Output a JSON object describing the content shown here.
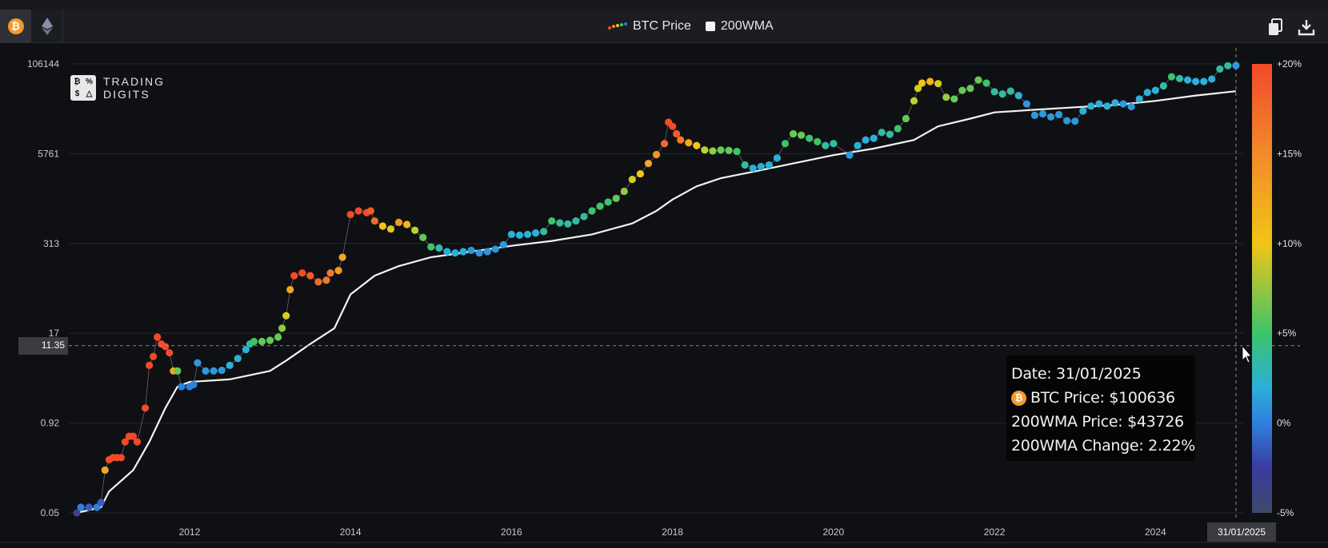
{
  "toolbar": {
    "coins": [
      {
        "icon": "bitcoin-icon",
        "active": true,
        "glyph": "₿"
      },
      {
        "icon": "ethereum-icon",
        "active": false
      }
    ],
    "legend": {
      "btc_label": "BTC Price",
      "wma_label": "200WMA"
    },
    "actions": [
      {
        "icon": "copy-icon"
      },
      {
        "icon": "download-icon"
      }
    ]
  },
  "logo": {
    "line1": "TRADING",
    "line2": "DIGITS",
    "glyphs": [
      "₿",
      "%",
      "$",
      "△"
    ]
  },
  "crosshair": {
    "y_value_label": "11.35",
    "x_value_label": "31/01/2025"
  },
  "tooltip": {
    "date": "Date: 31/01/2025",
    "btc_price": "BTC Price: $100636",
    "wma_price": "200WMA Price: $43726",
    "wma_change": "200WMA Change: 2.22%"
  },
  "colors": {
    "background": "#0f1013",
    "wma_line": "#f2f2f2",
    "grid": "#23252a",
    "scale": [
      "#3d4a6a",
      "#3b3b9e",
      "#2f7fe0",
      "#2bb0d8",
      "#3cc46a",
      "#b8d32a",
      "#f2c417",
      "#f28a2a",
      "#f24a2a"
    ]
  },
  "chart_data": {
    "type": "scatter",
    "y_scale": "log",
    "y_ticks": [
      0.05,
      0.92,
      17,
      313,
      5761,
      106144
    ],
    "y_tick_labels": [
      "0.05",
      "0.92",
      "17",
      "313",
      "5761",
      "106144"
    ],
    "ylim": [
      0.05,
      106144
    ],
    "x_ticks": [
      2012,
      2014,
      2016,
      2018,
      2020,
      2022,
      2024
    ],
    "x_tick_labels": [
      "2012",
      "2014",
      "2016",
      "2018",
      "2020",
      "2022",
      "2024"
    ],
    "xlim": [
      2010.5,
      2025.1
    ],
    "colorbar": {
      "labels": [
        "+20%",
        "+15%",
        "+10%",
        "+5%",
        "0%",
        "-5%"
      ],
      "range": [
        -5,
        20
      ]
    },
    "series": [
      {
        "name": "BTC Price",
        "points": [
          [
            2010.6,
            0.05,
            -3
          ],
          [
            2010.65,
            0.06,
            1
          ],
          [
            2010.75,
            0.06,
            0
          ],
          [
            2010.85,
            0.06,
            1
          ],
          [
            2010.9,
            0.07,
            0
          ],
          [
            2010.95,
            0.2,
            12
          ],
          [
            2011.0,
            0.28,
            19
          ],
          [
            2011.05,
            0.3,
            19
          ],
          [
            2011.1,
            0.3,
            19
          ],
          [
            2011.15,
            0.3,
            19
          ],
          [
            2011.2,
            0.5,
            20
          ],
          [
            2011.25,
            0.6,
            20
          ],
          [
            2011.3,
            0.6,
            20
          ],
          [
            2011.35,
            0.5,
            20
          ],
          [
            2011.45,
            1.5,
            20
          ],
          [
            2011.5,
            6.0,
            20
          ],
          [
            2011.55,
            8.0,
            20
          ],
          [
            2011.6,
            15,
            20
          ],
          [
            2011.65,
            12,
            20
          ],
          [
            2011.7,
            11,
            19
          ],
          [
            2011.75,
            9,
            18
          ],
          [
            2011.8,
            5,
            12
          ],
          [
            2011.85,
            5,
            6
          ],
          [
            2011.9,
            3,
            1
          ],
          [
            2012.0,
            3,
            1
          ],
          [
            2012.05,
            3.2,
            1
          ],
          [
            2012.1,
            6.5,
            2
          ],
          [
            2012.2,
            5,
            2
          ],
          [
            2012.3,
            5,
            2
          ],
          [
            2012.4,
            5.1,
            2
          ],
          [
            2012.5,
            6,
            3
          ],
          [
            2012.6,
            7.5,
            3
          ],
          [
            2012.7,
            10,
            3
          ],
          [
            2012.75,
            12,
            4
          ],
          [
            2012.8,
            13,
            5
          ],
          [
            2012.9,
            13,
            6
          ],
          [
            2013.0,
            13.5,
            6
          ],
          [
            2013.1,
            15,
            6
          ],
          [
            2013.15,
            20,
            7
          ],
          [
            2013.2,
            30,
            9
          ],
          [
            2013.25,
            70,
            12
          ],
          [
            2013.3,
            110,
            18
          ],
          [
            2013.4,
            120,
            19
          ],
          [
            2013.5,
            110,
            17
          ],
          [
            2013.6,
            90,
            16
          ],
          [
            2013.7,
            95,
            15
          ],
          [
            2013.75,
            120,
            15
          ],
          [
            2013.85,
            130,
            13
          ],
          [
            2013.9,
            200,
            12
          ],
          [
            2014.0,
            800,
            19
          ],
          [
            2014.1,
            900,
            19
          ],
          [
            2014.2,
            850,
            19
          ],
          [
            2014.25,
            900,
            17
          ],
          [
            2014.3,
            650,
            16
          ],
          [
            2014.4,
            550,
            10
          ],
          [
            2014.5,
            500,
            9
          ],
          [
            2014.6,
            620,
            13
          ],
          [
            2014.7,
            580,
            11
          ],
          [
            2014.8,
            480,
            8
          ],
          [
            2014.9,
            380,
            6
          ],
          [
            2015.0,
            280,
            5
          ],
          [
            2015.1,
            270,
            4
          ],
          [
            2015.2,
            240,
            3
          ],
          [
            2015.3,
            230,
            3
          ],
          [
            2015.4,
            240,
            3
          ],
          [
            2015.5,
            250,
            2
          ],
          [
            2015.6,
            230,
            2
          ],
          [
            2015.7,
            240,
            2
          ],
          [
            2015.8,
            260,
            2
          ],
          [
            2015.9,
            300,
            2
          ],
          [
            2016.0,
            420,
            3
          ],
          [
            2016.1,
            410,
            3
          ],
          [
            2016.2,
            420,
            3
          ],
          [
            2016.3,
            440,
            3
          ],
          [
            2016.4,
            460,
            4
          ],
          [
            2016.5,
            650,
            5
          ],
          [
            2016.6,
            610,
            4
          ],
          [
            2016.7,
            590,
            4
          ],
          [
            2016.8,
            650,
            4
          ],
          [
            2016.9,
            750,
            4
          ],
          [
            2017.0,
            900,
            5
          ],
          [
            2017.1,
            1050,
            5
          ],
          [
            2017.2,
            1200,
            5
          ],
          [
            2017.3,
            1350,
            6
          ],
          [
            2017.4,
            1700,
            7
          ],
          [
            2017.5,
            2500,
            9
          ],
          [
            2017.6,
            3000,
            10
          ],
          [
            2017.7,
            4200,
            12
          ],
          [
            2017.8,
            5600,
            13
          ],
          [
            2017.9,
            8000,
            16
          ],
          [
            2017.95,
            16000,
            20
          ],
          [
            2018.0,
            14000,
            19
          ],
          [
            2018.05,
            11000,
            17
          ],
          [
            2018.1,
            9000,
            15
          ],
          [
            2018.2,
            8200,
            12
          ],
          [
            2018.3,
            7500,
            10
          ],
          [
            2018.4,
            6500,
            8
          ],
          [
            2018.5,
            6300,
            7
          ],
          [
            2018.6,
            6500,
            6
          ],
          [
            2018.7,
            6400,
            6
          ],
          [
            2018.8,
            6200,
            5
          ],
          [
            2018.9,
            4000,
            4
          ],
          [
            2019.0,
            3600,
            3
          ],
          [
            2019.1,
            3800,
            3
          ],
          [
            2019.2,
            4000,
            3
          ],
          [
            2019.3,
            5000,
            3
          ],
          [
            2019.4,
            8000,
            5
          ],
          [
            2019.5,
            11000,
            6
          ],
          [
            2019.6,
            10500,
            6
          ],
          [
            2019.7,
            9500,
            5
          ],
          [
            2019.8,
            8500,
            5
          ],
          [
            2019.9,
            7500,
            4
          ],
          [
            2020.0,
            8000,
            4
          ],
          [
            2020.2,
            5500,
            2
          ],
          [
            2020.3,
            7500,
            3
          ],
          [
            2020.4,
            9000,
            3
          ],
          [
            2020.5,
            9500,
            3
          ],
          [
            2020.6,
            11500,
            4
          ],
          [
            2020.7,
            10800,
            4
          ],
          [
            2020.8,
            13000,
            5
          ],
          [
            2020.9,
            18000,
            6
          ],
          [
            2021.0,
            32000,
            8
          ],
          [
            2021.05,
            48000,
            9
          ],
          [
            2021.1,
            57000,
            10
          ],
          [
            2021.2,
            60000,
            11
          ],
          [
            2021.3,
            56000,
            9
          ],
          [
            2021.4,
            36000,
            7
          ],
          [
            2021.5,
            34000,
            6
          ],
          [
            2021.6,
            45000,
            6
          ],
          [
            2021.7,
            48000,
            6
          ],
          [
            2021.8,
            63000,
            6
          ],
          [
            2021.9,
            57000,
            5
          ],
          [
            2022.0,
            43000,
            4
          ],
          [
            2022.1,
            40000,
            4
          ],
          [
            2022.2,
            44000,
            4
          ],
          [
            2022.3,
            38000,
            3
          ],
          [
            2022.4,
            29000,
            2
          ],
          [
            2022.5,
            20000,
            2
          ],
          [
            2022.6,
            21000,
            2
          ],
          [
            2022.7,
            19000,
            2
          ],
          [
            2022.8,
            20500,
            2
          ],
          [
            2022.9,
            16800,
            2
          ],
          [
            2023.0,
            16500,
            2
          ],
          [
            2023.1,
            23000,
            3
          ],
          [
            2023.2,
            27000,
            3
          ],
          [
            2023.3,
            29000,
            3
          ],
          [
            2023.4,
            27000,
            3
          ],
          [
            2023.5,
            30000,
            3
          ],
          [
            2023.6,
            29000,
            2
          ],
          [
            2023.7,
            26500,
            2
          ],
          [
            2023.8,
            34000,
            3
          ],
          [
            2023.9,
            42000,
            3
          ],
          [
            2024.0,
            45000,
            3
          ],
          [
            2024.1,
            52000,
            4
          ],
          [
            2024.2,
            70000,
            5
          ],
          [
            2024.3,
            66000,
            4
          ],
          [
            2024.4,
            63000,
            3
          ],
          [
            2024.5,
            60000,
            3
          ],
          [
            2024.6,
            60000,
            3
          ],
          [
            2024.7,
            65000,
            3
          ],
          [
            2024.8,
            90000,
            4
          ],
          [
            2024.9,
            100000,
            4
          ],
          [
            2025.0,
            100636,
            2
          ]
        ]
      },
      {
        "name": "200WMA",
        "points": [
          [
            2010.6,
            0.05
          ],
          [
            2010.9,
            0.06
          ],
          [
            2011.0,
            0.1
          ],
          [
            2011.3,
            0.2
          ],
          [
            2011.5,
            0.5
          ],
          [
            2011.7,
            1.5
          ],
          [
            2011.85,
            3.0
          ],
          [
            2012.0,
            3.5
          ],
          [
            2012.5,
            3.8
          ],
          [
            2013.0,
            5
          ],
          [
            2013.2,
            7
          ],
          [
            2013.5,
            12
          ],
          [
            2013.8,
            20
          ],
          [
            2014.0,
            60
          ],
          [
            2014.3,
            110
          ],
          [
            2014.6,
            150
          ],
          [
            2015.0,
            200
          ],
          [
            2015.5,
            240
          ],
          [
            2016.0,
            290
          ],
          [
            2016.5,
            340
          ],
          [
            2017.0,
            420
          ],
          [
            2017.5,
            600
          ],
          [
            2017.8,
            900
          ],
          [
            2018.0,
            1300
          ],
          [
            2018.3,
            2000
          ],
          [
            2018.6,
            2600
          ],
          [
            2019.0,
            3200
          ],
          [
            2019.5,
            4200
          ],
          [
            2020.0,
            5500
          ],
          [
            2020.5,
            6800
          ],
          [
            2021.0,
            9000
          ],
          [
            2021.3,
            14000
          ],
          [
            2021.7,
            18000
          ],
          [
            2022.0,
            22000
          ],
          [
            2022.5,
            24000
          ],
          [
            2023.0,
            26000
          ],
          [
            2023.5,
            28000
          ],
          [
            2024.0,
            32000
          ],
          [
            2024.5,
            38000
          ],
          [
            2025.0,
            43726
          ]
        ]
      }
    ],
    "crosshair_x": 2025.0,
    "crosshair_y": 11.35
  }
}
